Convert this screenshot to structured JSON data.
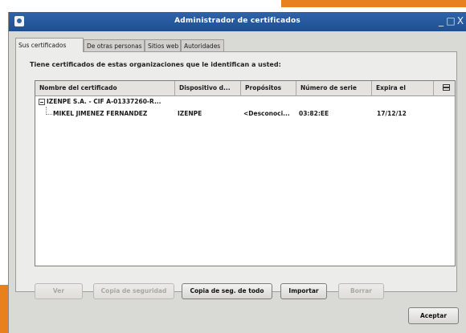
{
  "window": {
    "title": "Administrador de certificados",
    "controls": {
      "minimize": "_",
      "maximize": "□",
      "close": "X"
    }
  },
  "tabs": [
    {
      "label": "Sus certificados",
      "active": true
    },
    {
      "label": "De otras personas",
      "active": false
    },
    {
      "label": "Sitios web",
      "active": false
    },
    {
      "label": "Autoridades",
      "active": false
    }
  ],
  "panel": {
    "description": "Tiene certificados de estas organizaciones que le identifican a usted:"
  },
  "table": {
    "columns": [
      "Nombre del certificado",
      "Dispositivo d...",
      "Propósitos",
      "Número de serie",
      "Expira el"
    ],
    "groups": [
      {
        "name": "IZENPE S.A. - CIF A-01337260-R...",
        "rows": [
          {
            "name": "MIKEL JIMENEZ FERNANDEZ",
            "device": "IZENPE",
            "purposes": "<Desconoci...",
            "serial": "03:82:EE",
            "expires": "17/12/12"
          }
        ]
      }
    ]
  },
  "buttons": {
    "view": "Ver",
    "backup": "Copia de seguridad",
    "backup_all": "Copia de seg. de todo",
    "import": "Importar",
    "delete": "Borrar",
    "accept": "Aceptar"
  },
  "colors": {
    "accent": "#e8801e",
    "titlebar": "#2f63a9",
    "window_bg": "#d9d9d6"
  }
}
